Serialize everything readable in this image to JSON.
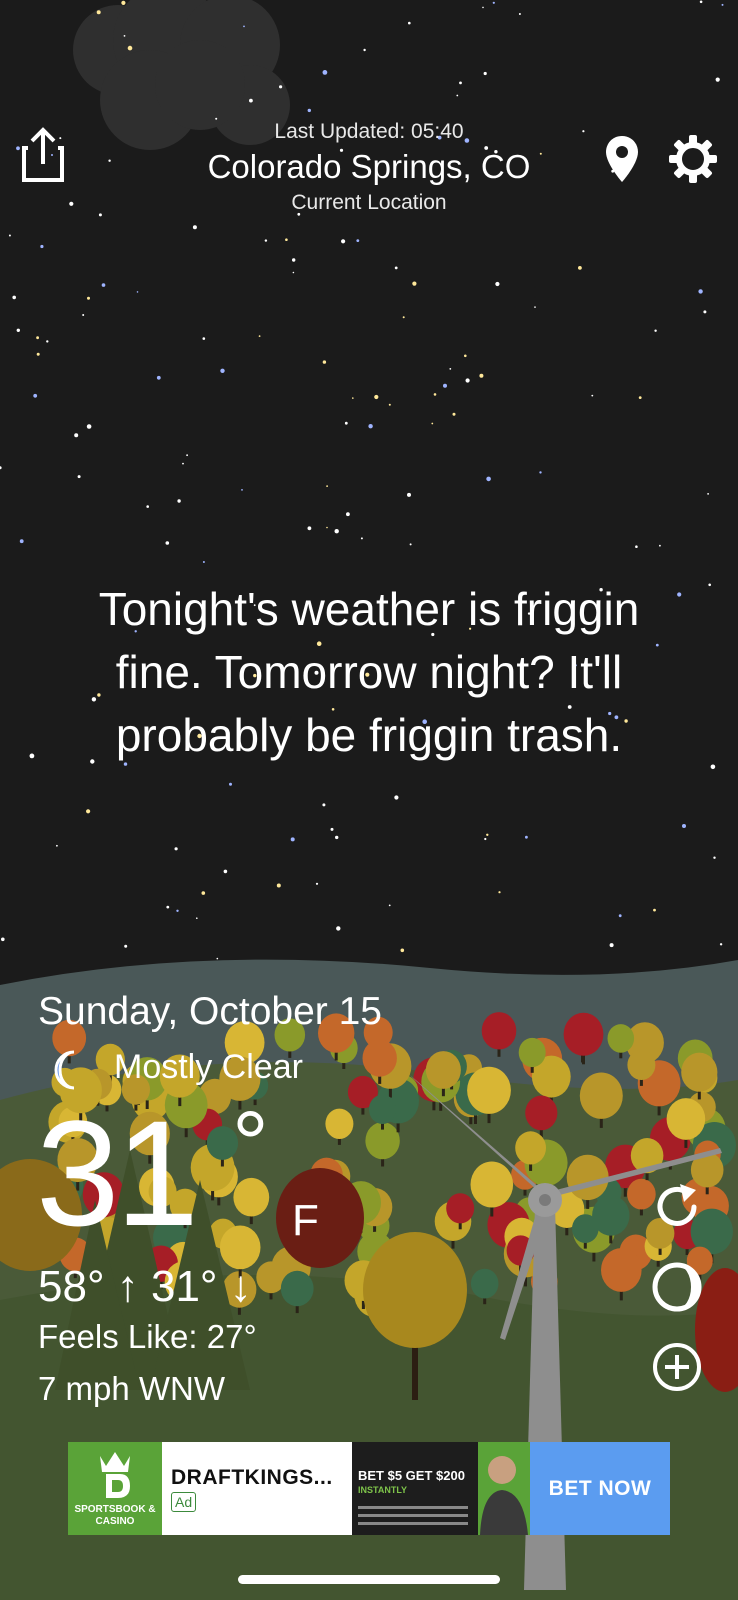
{
  "header": {
    "last_updated": "Last Updated: 05:40",
    "location": "Colorado Springs, CO",
    "location_sub": "Current Location"
  },
  "forecast_quip": "Tonight's weather is friggin fine. Tomorrow night? It'll probably be friggin trash.",
  "current": {
    "date": "Sunday, October 15",
    "condition": "Mostly Clear",
    "condition_icon": "crescent-moon-icon",
    "temperature": "31",
    "degree_symbol": "°",
    "unit": "F",
    "high_low": "58° ↑ 31° ↓",
    "feels_like": "Feels Like: 27°",
    "wind": "7 mph WNW"
  },
  "controls": {
    "share_icon": "share-icon",
    "location_icon": "location-pin-icon",
    "settings_icon": "gear-icon",
    "refresh_icon": "refresh-icon",
    "theme_icon": "moon-phase-icon",
    "add_icon": "add-location-icon"
  },
  "ad": {
    "logo_text": "SPORTSBOOK & CASINO",
    "title": "DRAFTKINGS...",
    "badge": "Ad",
    "banner_text": "BET $5 GET $200",
    "banner_sub": "INSTANTLY",
    "cta": "BET NOW"
  },
  "colors": {
    "sky": "#1b1b1b",
    "hills_back": "#4a5a5a",
    "hills_front": "#4a5a32",
    "ad_green": "#5aa338",
    "ad_blue": "#5b9cf0",
    "moon_blue": "#5b8de8"
  }
}
